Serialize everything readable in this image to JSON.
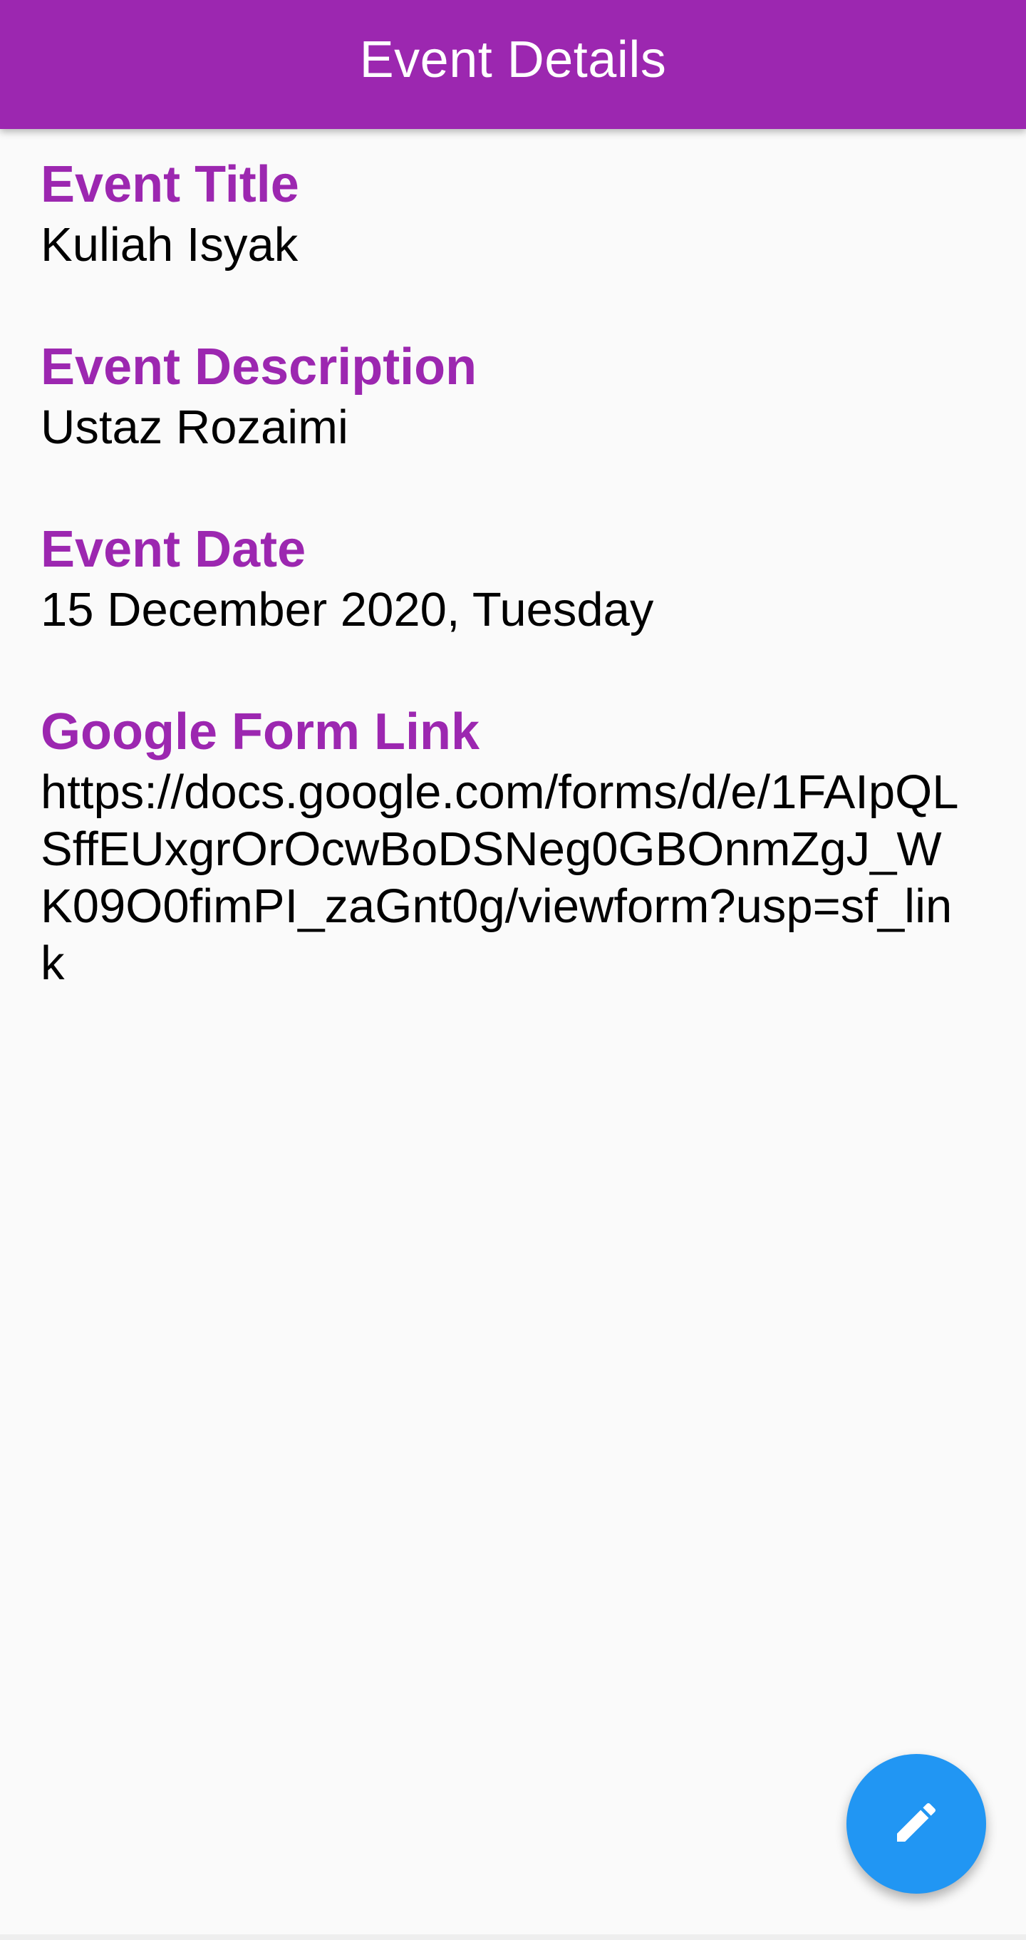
{
  "app_bar": {
    "title": "Event Details"
  },
  "fields": {
    "title": {
      "label": "Event Title",
      "value": "Kuliah Isyak"
    },
    "description": {
      "label": "Event Description",
      "value": "Ustaz Rozaimi"
    },
    "date": {
      "label": "Event Date",
      "value": "15 December 2020, Tuesday"
    },
    "link": {
      "label": "Google Form Link",
      "value": "https://docs.google.com/forms/d/e/1FAIpQLSffEUxgrOrOcwBoDSNeg0GBOnmZgJ_WK09O0fimPI_zaGnt0g/viewform?usp=sf_link"
    }
  },
  "fab": {
    "icon": "edit-icon"
  },
  "colors": {
    "primary": "#9c27b0",
    "accent": "#2196f3",
    "background": "#fafafa"
  }
}
